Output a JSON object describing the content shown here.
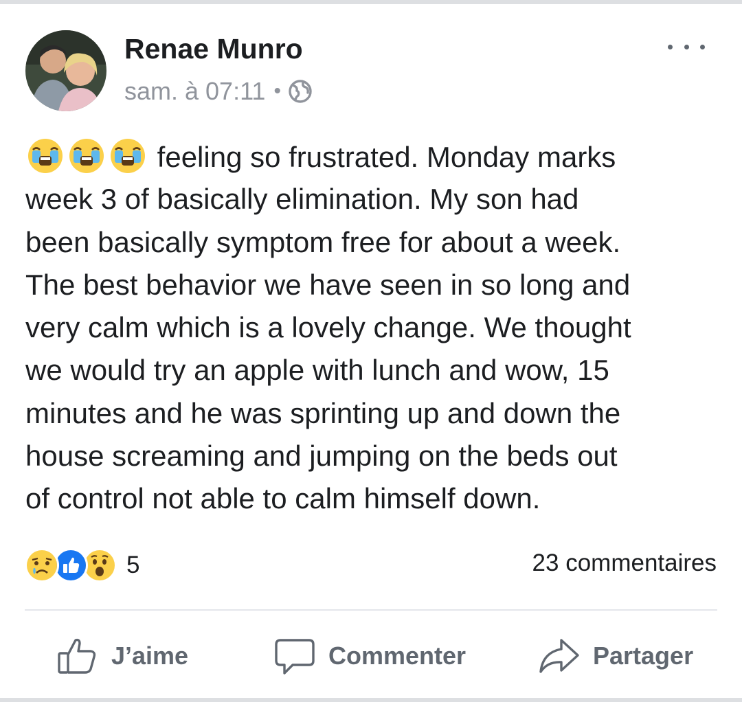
{
  "post": {
    "author": "Renae Munro",
    "timestamp": "sam. à 07:11",
    "separator": "•",
    "audience_icon": "globe-icon",
    "leading_emojis": [
      "crying-face-icon",
      "crying-face-icon",
      "crying-face-icon"
    ],
    "text_lines": [
      "feeling so frustrated. Monday marks",
      "week 3 of basically elimination. My son had",
      "been basically symptom free for about a week.",
      "The best behavior we have seen in so long and",
      "very calm which is a lovely change. We thought",
      "we would try an apple with lunch and wow, 15",
      "minutes and he was sprinting up and down the",
      "house screaming and jumping on the beds out",
      "of control not able to calm himself down."
    ]
  },
  "reactions": {
    "icons": [
      "sad-reaction-icon",
      "like-reaction-icon",
      "wow-reaction-icon"
    ],
    "count": "5"
  },
  "comments": {
    "count_label": "23 commentaires"
  },
  "actions": {
    "like_label": "J’aime",
    "comment_label": "Commenter",
    "share_label": "Partager"
  },
  "colors": {
    "text": "#1c1e21",
    "secondary_text": "#90949c",
    "action_text": "#606770",
    "like_blue": "#1877f2",
    "emoji_yellow": "#fbd04a"
  }
}
